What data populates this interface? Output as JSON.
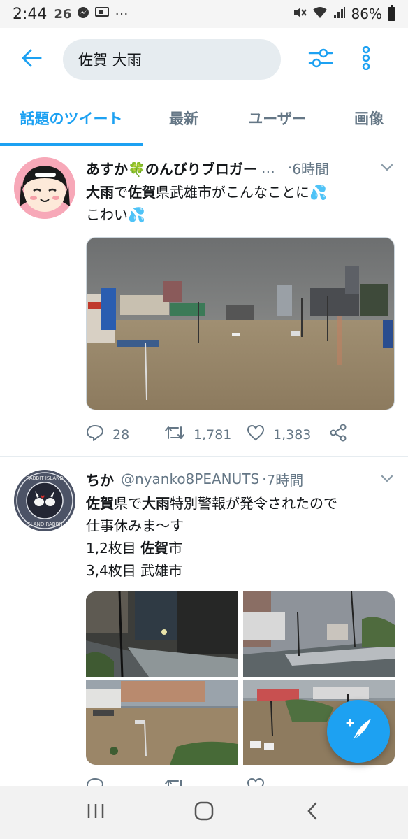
{
  "status_bar": {
    "time": "2:44",
    "temp": "26",
    "dots": "···",
    "battery": "86%"
  },
  "search": {
    "query": "佐賀 大雨"
  },
  "tabs": [
    {
      "label": "話題のツイート",
      "active": true
    },
    {
      "label": "最新",
      "active": false
    },
    {
      "label": "ユーザー",
      "active": false
    },
    {
      "label": "画像",
      "active": false
    }
  ],
  "tweets": [
    {
      "display_name": "あすか🍀のんびりブロガー",
      "ellipsis": "…",
      "timestamp": "6時間",
      "lines": [
        "大雨で佐賀県武雄市がこんなことに💦",
        "こわい💦"
      ],
      "reply_count": "28",
      "retweet_count": "1,781",
      "like_count": "1,383"
    },
    {
      "display_name": "ちか",
      "handle": "@nyanko8PEANUTS",
      "timestamp": "7時間",
      "lines": [
        "佐賀県で大雨特別警報が発令されたので",
        "仕事休みま〜す",
        "1,2枚目 佐賀市",
        "3,4枚目 武雄市"
      ]
    }
  ],
  "colors": {
    "accent": "#1da1f2",
    "text": "#14171a",
    "muted": "#657786",
    "divider": "#e6ecf0"
  }
}
